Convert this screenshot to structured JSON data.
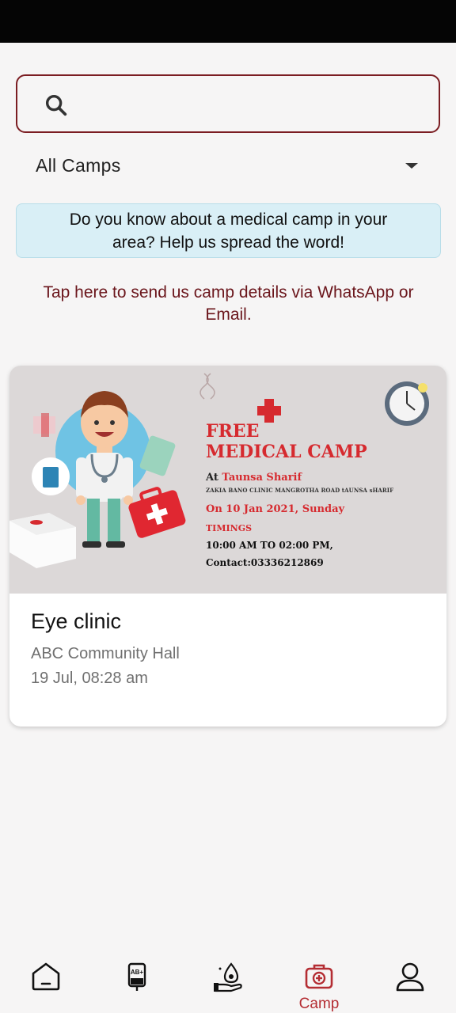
{
  "search": {
    "placeholder": "",
    "value": ""
  },
  "filter": {
    "label": "All Camps"
  },
  "info_banner": {
    "text": "Do you know about a medical camp in your area? Help us spread the word!"
  },
  "whatsapp_link": {
    "text": "Tap here to send us camp details via WhatsApp or Email."
  },
  "camps": [
    {
      "title": "Eye clinic",
      "venue": "ABC Community Hall",
      "datetime": "19 Jul, 08:28 am",
      "banner": {
        "title_line1": "FREE",
        "title_line2": "MEDICAL CAMP",
        "at_label": "At",
        "location": "Taunsa Sharif",
        "address": "ZAKIA BANO CLINIC MANGROTHA ROAD tAUNSA sHARIF",
        "date": "On 10 Jan 2021, Sunday",
        "timings_label": "TIMINGS",
        "time": "10:00 AM TO 02:00 PM,",
        "contact": "Contact:03336212869"
      }
    }
  ],
  "bottom_nav": {
    "active": "camp",
    "items": [
      {
        "id": "home",
        "label": "",
        "icon": "home-icon"
      },
      {
        "id": "blood",
        "label": "",
        "icon": "blood-bag-icon",
        "icon_text": "AB+"
      },
      {
        "id": "donate",
        "label": "",
        "icon": "donate-drop-icon"
      },
      {
        "id": "camp",
        "label": "Camp",
        "icon": "medical-kit-icon"
      },
      {
        "id": "profile",
        "label": "",
        "icon": "person-icon"
      }
    ]
  },
  "colors": {
    "accent": "#7b1d22",
    "active_nav": "#b42d33",
    "banner_bg": "#d9eff6",
    "link_text": "#6b161c"
  }
}
